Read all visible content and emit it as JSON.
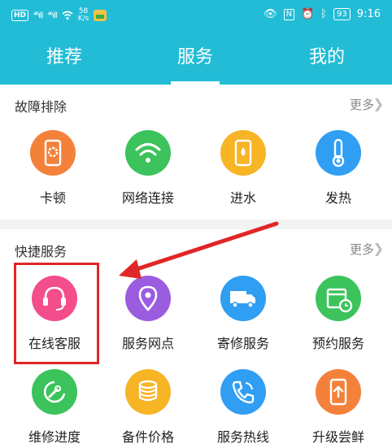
{
  "status_bar": {
    "hd_badge": "HD",
    "signal1": "⁴⁶ıll",
    "signal2": "⁴⁶ıll",
    "speed_value": "58",
    "speed_unit": "K/s",
    "battery": "93",
    "time": "9:16"
  },
  "tabs": [
    {
      "label": "推荐"
    },
    {
      "label": "服务"
    },
    {
      "label": "我的"
    }
  ],
  "troubleshoot": {
    "title": "故障排除",
    "more": "更多",
    "items": [
      {
        "label": "卡顿",
        "icon": "phone-gear-icon",
        "color": "#f4813a"
      },
      {
        "label": "网络连接",
        "icon": "wifi-icon",
        "color": "#3cc35c"
      },
      {
        "label": "进水",
        "icon": "phone-water-drop-icon",
        "color": "#f7b425"
      },
      {
        "label": "发热",
        "icon": "thermometer-icon",
        "color": "#2f9ef3"
      }
    ]
  },
  "quick_service": {
    "title": "快捷服务",
    "more": "更多",
    "items": [
      {
        "label": "在线客服",
        "icon": "headset-icon",
        "color": "#f44d8c"
      },
      {
        "label": "服务网点",
        "icon": "location-pin-icon",
        "color": "#9b5de0"
      },
      {
        "label": "寄修服务",
        "icon": "delivery-truck-icon",
        "color": "#2f9ef3"
      },
      {
        "label": "预约服务",
        "icon": "calendar-clock-icon",
        "color": "#3cc35c"
      },
      {
        "label": "维修进度",
        "icon": "wrench-progress-icon",
        "color": "#3cc35c"
      },
      {
        "label": "备件价格",
        "icon": "coins-icon",
        "color": "#f7b425"
      },
      {
        "label": "服务热线",
        "icon": "phone-call-icon",
        "color": "#2f9ef3"
      },
      {
        "label": "升级尝鲜",
        "icon": "phone-upgrade-icon",
        "color": "#f4813a"
      }
    ]
  },
  "colors": {
    "header": "#22bcd6",
    "highlight": "#e02626"
  }
}
